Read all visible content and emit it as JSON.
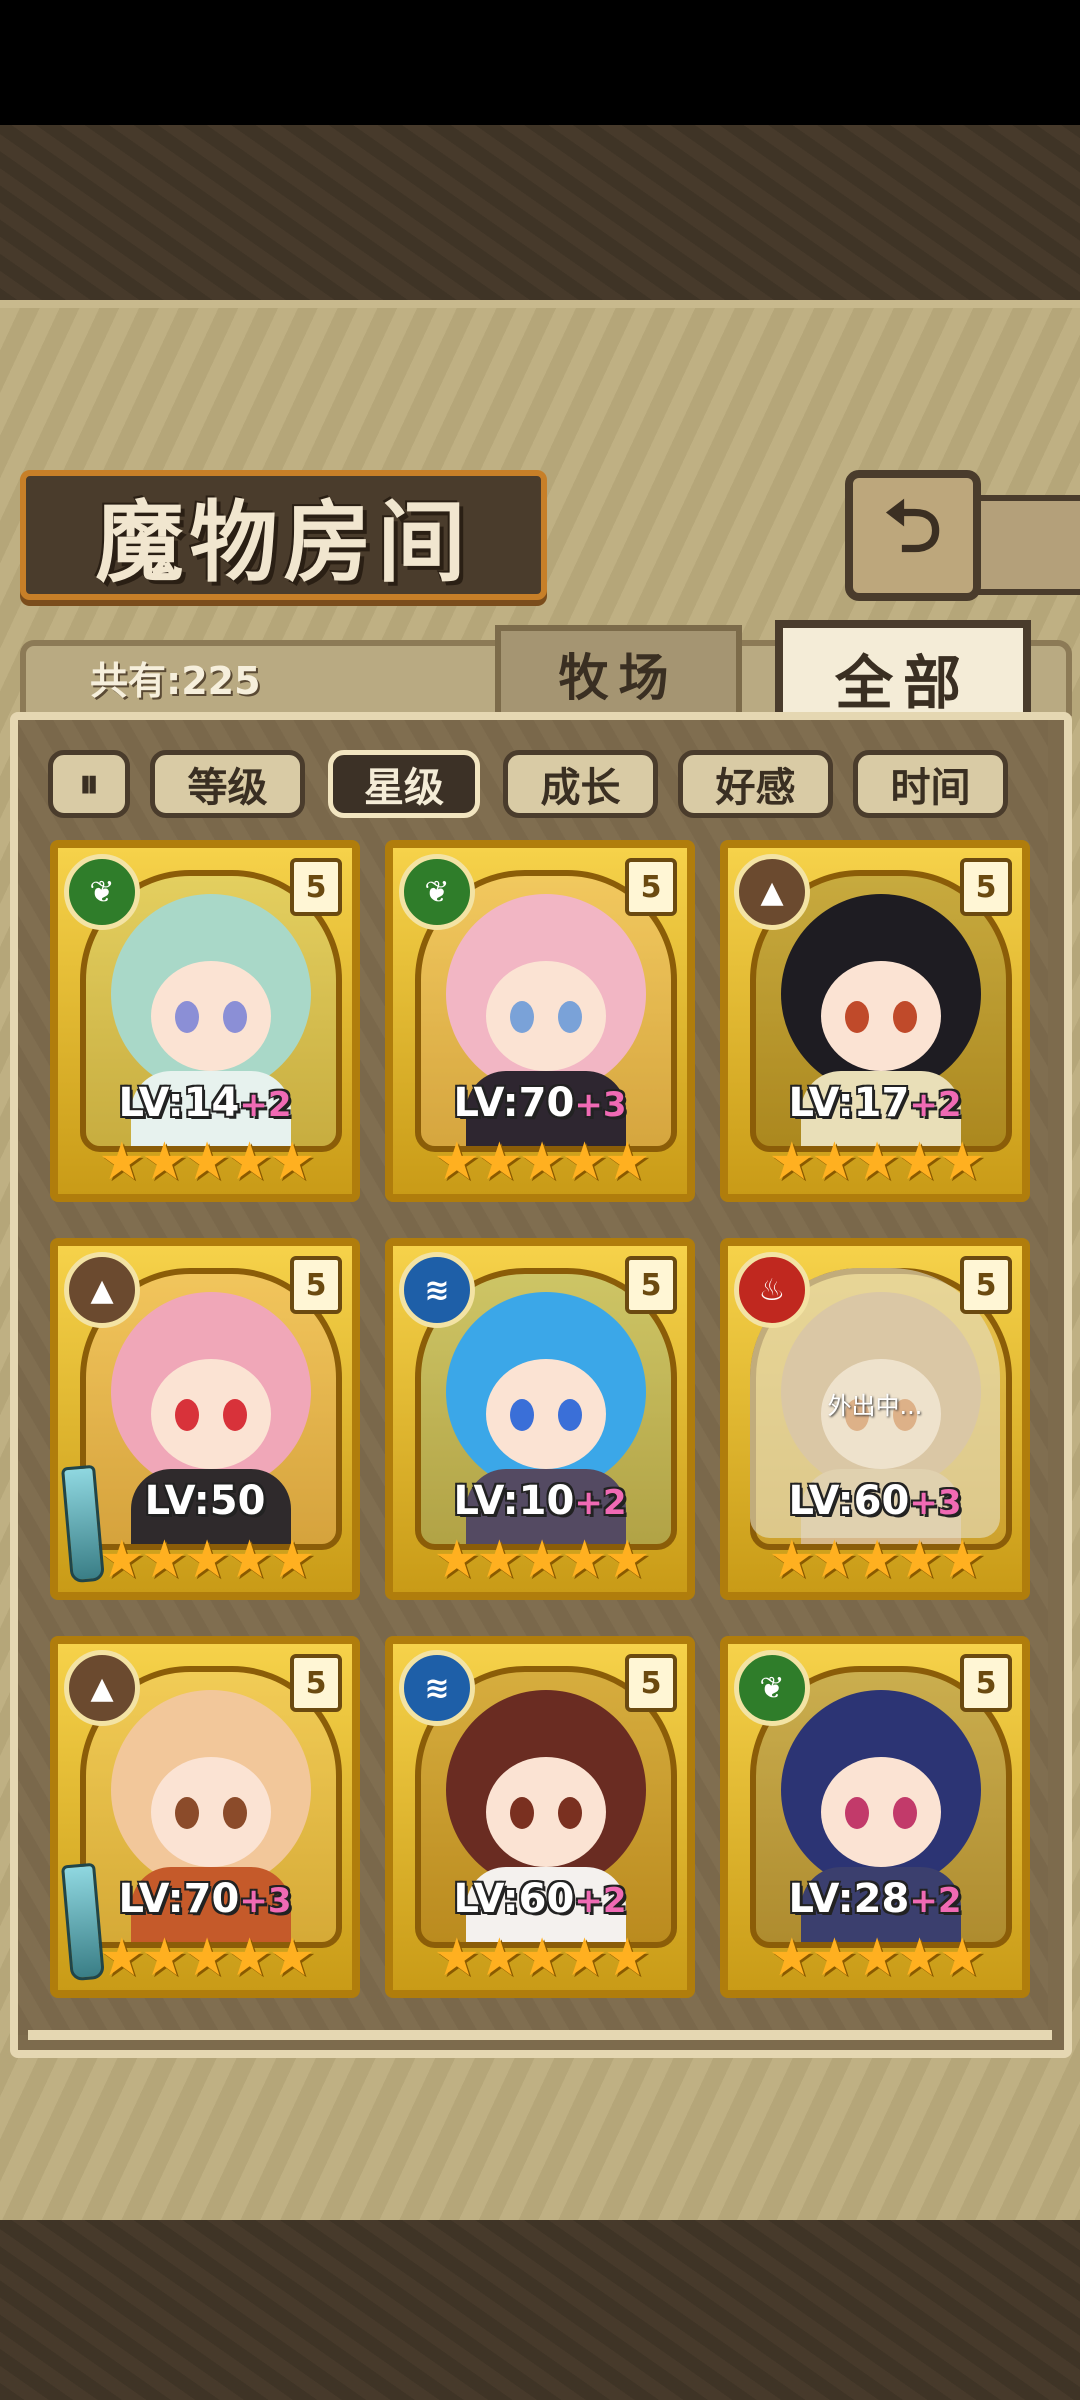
{
  "title": "魔物房间",
  "back_icon": "back-arrow-icon",
  "total_count": "共有:225",
  "tabs": [
    {
      "label": "牧场",
      "active": false
    },
    {
      "label": "全部",
      "active": true
    }
  ],
  "sort_buttons": [
    {
      "label": "等级",
      "active": false
    },
    {
      "label": "星级",
      "active": true
    },
    {
      "label": "成长",
      "active": false
    },
    {
      "label": "好感",
      "active": false
    },
    {
      "label": "时间",
      "active": false
    }
  ],
  "sort_order_icon": "sort-toggle-icon",
  "cards": [
    {
      "element": "leaf",
      "rank": "5",
      "level": "LV:14",
      "bonus": "+2",
      "stars": 5
    },
    {
      "element": "leaf",
      "rank": "5",
      "level": "LV:70",
      "bonus": "+3",
      "stars": 5
    },
    {
      "element": "earth",
      "rank": "5",
      "level": "LV:17",
      "bonus": "+2",
      "stars": 5
    },
    {
      "element": "earth",
      "rank": "5",
      "level": "LV:50",
      "bonus": "",
      "stars": 5,
      "weapon": true
    },
    {
      "element": "water",
      "rank": "5",
      "level": "LV:10",
      "bonus": "+2",
      "stars": 5
    },
    {
      "element": "fire",
      "rank": "5",
      "level": "LV:60",
      "bonus": "+3",
      "stars": 5,
      "status": "外出中..."
    },
    {
      "element": "earth",
      "rank": "5",
      "level": "LV:70",
      "bonus": "+3",
      "stars": 5,
      "weapon": true
    },
    {
      "element": "water",
      "rank": "5",
      "level": "LV:60",
      "bonus": "+2",
      "stars": 5
    },
    {
      "element": "leaf",
      "rank": "5",
      "level": "LV:28",
      "bonus": "+2",
      "stars": 5
    }
  ],
  "colors": {
    "leaf": "#2f7d2a",
    "earth": "#6b4a2f",
    "water": "#1e5fa8",
    "fire": "#c0281f",
    "star": "#ffb020",
    "bonus": "#f06ab4"
  }
}
